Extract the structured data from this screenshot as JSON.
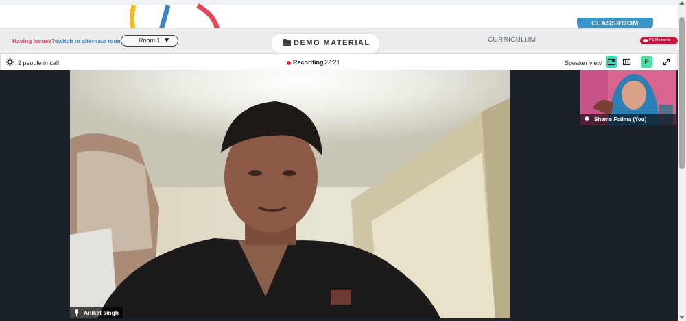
{
  "header": {
    "classroom_tab": "CLASSROOM"
  },
  "toolbar": {
    "issue_text": "Having issues?",
    "issue_link": "switch to alternate room",
    "room_selected": "Room 1",
    "demo_material": "DEMO MATERIAL",
    "curriculum": "CURRICULUM",
    "moments": "PS Moments"
  },
  "call": {
    "people_count": "2 people in call",
    "recording_label": "Recording",
    "recording_time": "22:21",
    "view_label": "Speaker view",
    "participant_badge": "P",
    "main_participant": "Aniket singh",
    "self_participant": "Shams Fatima (You)"
  },
  "icons": [
    "gear-icon",
    "folder-icon",
    "caret-down-icon",
    "speaker-view-icon",
    "grid-view-icon",
    "expand-icon",
    "mic-icon"
  ],
  "colors": {
    "classroom_tab": "#3a95c8",
    "issue_text": "#d23a55",
    "issue_link": "#2f80b5",
    "recording_dot": "#e3202f",
    "active_view": "#34e0b9",
    "moments_badge": "#c3153d",
    "call_background": "#1a2128"
  }
}
